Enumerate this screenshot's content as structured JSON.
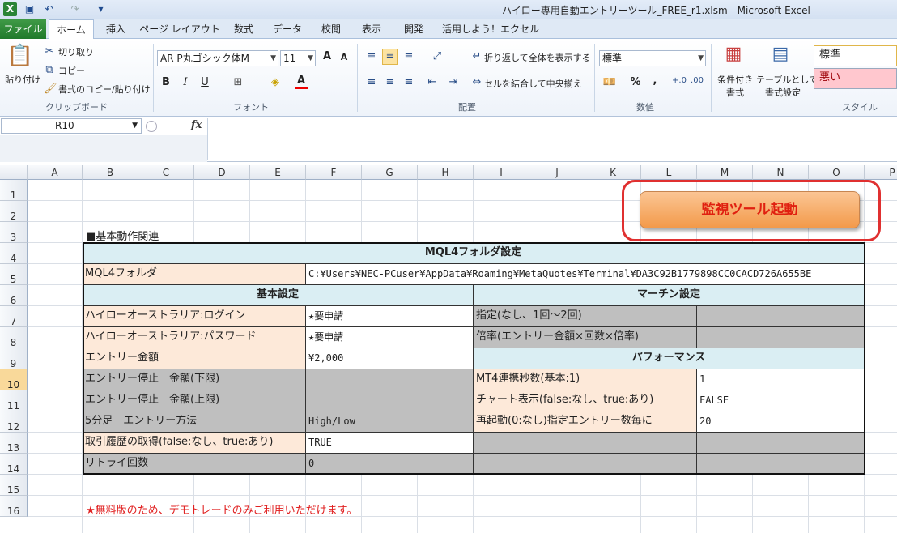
{
  "window": {
    "title": "ハイロー専用自動エントリーツール_FREE_r1.xlsm - Microsoft Excel"
  },
  "tabs": [
    "ファイル",
    "ホーム",
    "挿入",
    "ページ レイアウト",
    "数式",
    "データ",
    "校閲",
    "表示",
    "開発",
    "活用しよう！エクセル"
  ],
  "ribbon": {
    "clipboard": {
      "paste": "貼り付け",
      "cut": "切り取り",
      "copy": "コピー",
      "format_painter": "書式のコピー/貼り付け",
      "label": "クリップボード"
    },
    "font": {
      "name": "AR P丸ゴシック体M",
      "size": "11",
      "label": "フォント",
      "bold": "B",
      "italic": "I",
      "underline": "U",
      "grow": "A",
      "shrink": "A",
      "font_color": "A"
    },
    "alignment": {
      "wrap": "折り返して全体を表示する",
      "merge": "セルを結合して中央揃え",
      "label": "配置"
    },
    "number": {
      "format": "標準",
      "percent": "%",
      "comma": ",",
      "label": "数値"
    },
    "styles": {
      "conditional": "条件付き\n書式",
      "conditional_l1": "条件付き",
      "conditional_l2": "書式",
      "table_l1": "テーブルとして",
      "table_l2": "書式設定",
      "normal": "標準",
      "bad": "悪い",
      "label": "スタイル"
    }
  },
  "formula_bar": {
    "name_box": "R10",
    "fx": "fx",
    "value": ""
  },
  "columns": [
    "A",
    "B",
    "C",
    "D",
    "E",
    "F",
    "G",
    "H",
    "I",
    "J",
    "K",
    "L",
    "M",
    "N",
    "O",
    "P"
  ],
  "rows": [
    "1",
    "2",
    "3",
    "4",
    "5",
    "6",
    "7",
    "8",
    "9",
    "10",
    "11",
    "12",
    "13",
    "14",
    "15",
    "16"
  ],
  "selected_row": "10",
  "sheet": {
    "section_title": "■基本動作関連",
    "launch_button": "監視ツール起動",
    "mql4_header": "MQL4フォルダ設定",
    "mql4_label": "MQL4フォルダ",
    "mql4_value": "C:¥Users¥NEC-PCuser¥AppData¥Roaming¥MetaQuotes¥Terminal¥DA3C92B1779898CC0CACD726A655BE",
    "basic_header": "基本設定",
    "martin_header": "マーチン設定",
    "perf_header": "パフォーマンス",
    "basic": [
      {
        "label": "ハイローオーストラリア:ログイン",
        "value": "★要申請",
        "shade": "peach"
      },
      {
        "label": "ハイローオーストラリア:パスワード",
        "value": "★要申請",
        "shade": "peach"
      },
      {
        "label": "エントリー金額",
        "value": "¥2,000",
        "shade": "peach"
      },
      {
        "label": "エントリー停止　金額(下限)",
        "value": "",
        "shade": "grey"
      },
      {
        "label": "エントリー停止　金額(上限)",
        "value": "",
        "shade": "grey"
      },
      {
        "label": "5分足　エントリー方法",
        "value": "High/Low",
        "shade": "grey"
      },
      {
        "label": "取引履歴の取得(false:なし、true:あり)",
        "value": "TRUE",
        "shade": "peach"
      },
      {
        "label": "リトライ回数",
        "value": "0",
        "shade": "grey"
      }
    ],
    "martin": [
      {
        "label": "指定(なし、1回～2回)",
        "value": ""
      },
      {
        "label": "倍率(エントリー金額×回数×倍率)",
        "value": ""
      }
    ],
    "perf": [
      {
        "label": "MT4連携秒数(基本:1)",
        "value": "1"
      },
      {
        "label": "チャート表示(false:なし、true:あり)",
        "value": "FALSE"
      },
      {
        "label": "再起動(0:なし)指定エントリー数毎に",
        "value": "20"
      }
    ],
    "footnote": "★無料版のため、デモトレードのみご利用いただけます。"
  },
  "colors": {
    "peach": "#fde9d9",
    "blue": "#daeef3",
    "grey": "#bfbfbf",
    "accent_red": "#e03030",
    "file_tab": "#2a8436"
  }
}
